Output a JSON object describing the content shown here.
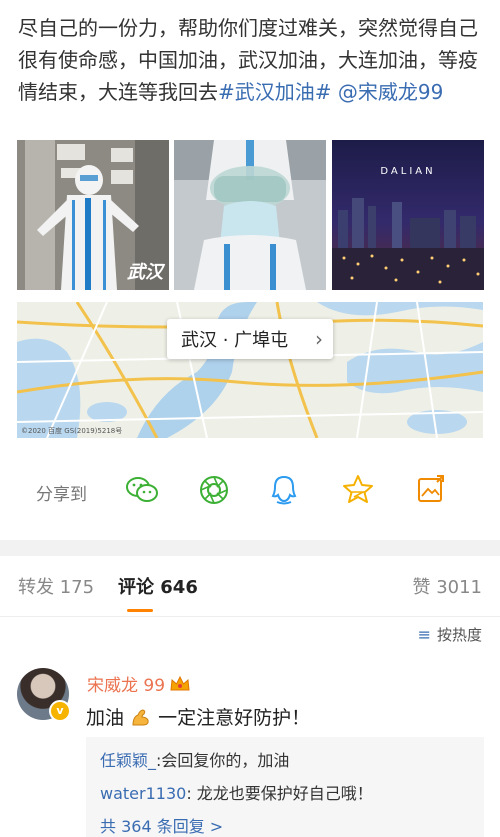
{
  "post": {
    "text": "尽自己的一份力，帮助你们度过难关，突然觉得自己很有使命感，中国加油，武汉加油，大连加油，等疫情结束，大连等我回去",
    "hashtag": "#武汉加油#",
    "mention": "@宋威龙99"
  },
  "photos": {
    "photo1_watermark": "武汉",
    "photo3_caption": "DALIAN"
  },
  "map": {
    "location": "武汉 · 广埠屯",
    "credit": "©2020 百度 GS(2019)5218号"
  },
  "share": {
    "label": "分享到",
    "icons": [
      "wechat-icon",
      "moments-icon",
      "qq-icon",
      "qzone-icon",
      "save-image-icon"
    ]
  },
  "tabs": {
    "repost": "转发 175",
    "comment": "评论 646",
    "like": "赞 3011"
  },
  "sort": {
    "label": "按热度"
  },
  "comment": {
    "author": "宋威龙 99",
    "text_before": "加油",
    "text_after": "一定注意好防护！",
    "replies": [
      {
        "author": "任颖颖_",
        "text": ":会回复你的，加油"
      },
      {
        "author": "water1130",
        "text": ": 龙龙也要保护好自己哦！"
      }
    ],
    "more": "共 364 条回复 >"
  },
  "colors": {
    "link": "#3a6cb2",
    "accent": "#ff8200",
    "username": "#eb7350"
  }
}
